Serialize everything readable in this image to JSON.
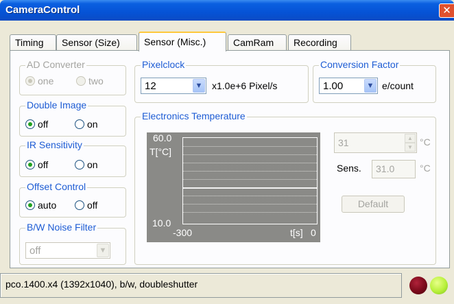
{
  "window": {
    "title": "CameraControl",
    "close_glyph": "✕"
  },
  "tabs": [
    {
      "label": "Timing",
      "active": false
    },
    {
      "label": "Sensor (Size)",
      "active": false
    },
    {
      "label": "Sensor (Misc.)",
      "active": true
    },
    {
      "label": "CamRam",
      "active": false
    },
    {
      "label": "Recording",
      "active": false
    }
  ],
  "ad_converter": {
    "label": "AD Converter",
    "options": [
      "one",
      "two"
    ],
    "selected": "one",
    "enabled": false
  },
  "double_image": {
    "label": "Double Image",
    "options": [
      "off",
      "on"
    ],
    "selected": "off"
  },
  "ir_sensitivity": {
    "label": "IR Sensitivity",
    "options": [
      "off",
      "on"
    ],
    "selected": "off"
  },
  "offset_control": {
    "label": "Offset Control",
    "options": [
      "auto",
      "off"
    ],
    "selected": "auto"
  },
  "bw_noise_filter": {
    "label": "B/W Noise Filter",
    "value": "off",
    "enabled": false
  },
  "pixelclock": {
    "label": "Pixelclock",
    "value": "12",
    "unit": "x1.0e+6 Pixel/s"
  },
  "conversion_factor": {
    "label": "Conversion Factor",
    "value": "1.00",
    "unit": "e/count"
  },
  "electronics_temperature": {
    "label": "Electronics Temperature",
    "graph": {
      "y_max": "60.0",
      "y_unit": "T[°C]",
      "y_min": "10.0",
      "x_min": "-300",
      "x_unit": "t[s]",
      "x_max": "0",
      "trace_value": 31.0
    },
    "setpoint": {
      "value": "31",
      "unit": "°C"
    },
    "sens": {
      "label": "Sens.",
      "value": "31.0",
      "unit": "°C"
    },
    "default_button": "Default"
  },
  "status": {
    "text": "pco.1400.x4 (1392x1040), b/w, doubleshutter"
  },
  "leds": {
    "left_color": "#7a0a1a",
    "right_color": "#b8f03a"
  },
  "icons": {
    "dropdown": "chevron-down-icon",
    "spin_up": "spin-up-icon",
    "spin_down": "spin-down-icon"
  }
}
